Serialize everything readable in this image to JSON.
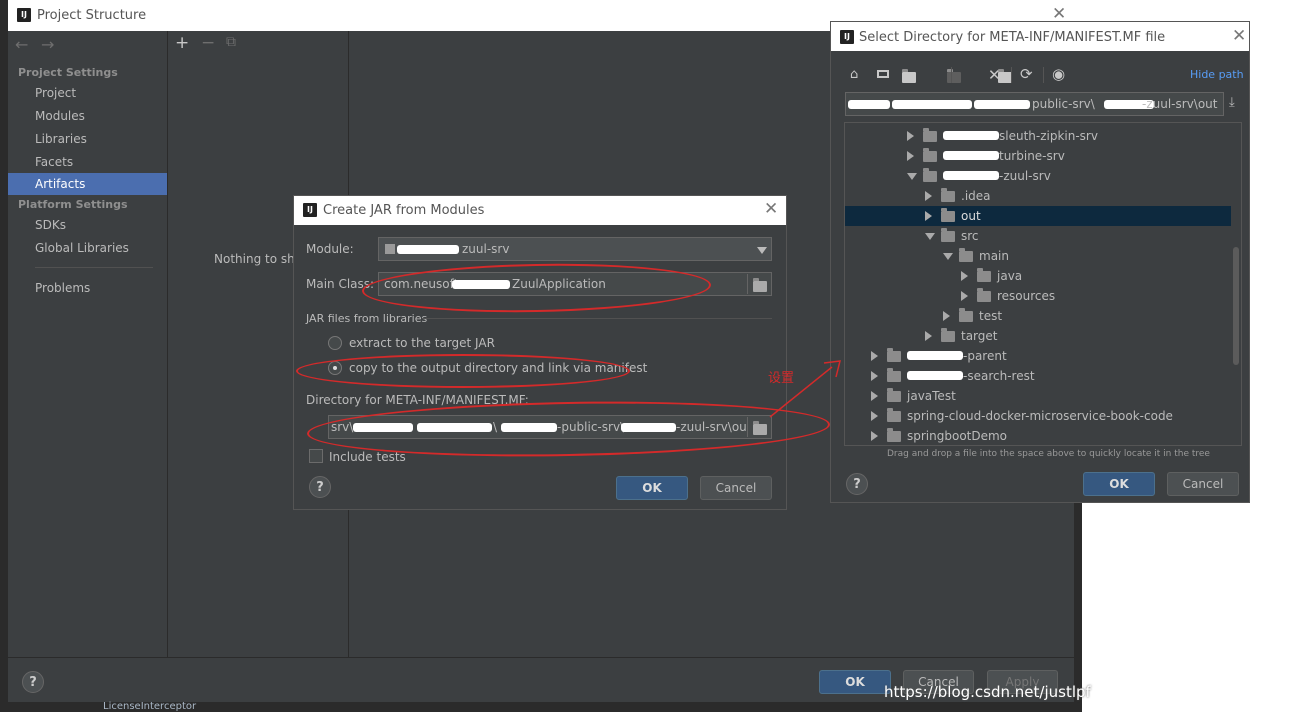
{
  "project_structure": {
    "title": "Project Structure",
    "icon_text": "IJ",
    "nav_back": "←",
    "nav_forward": "→",
    "toolbar_add": "+",
    "toolbar_remove": "−",
    "toolbar_copy": "⧉",
    "sections": [
      {
        "header": "Project Settings",
        "items": [
          "Project",
          "Modules",
          "Libraries",
          "Facets",
          "Artifacts"
        ]
      },
      {
        "header": "Platform Settings",
        "items": [
          "SDKs",
          "Global Libraries"
        ]
      }
    ],
    "problems": "Problems",
    "selected_item": "Artifacts",
    "empty_text": "Nothing to sho",
    "ok_label": "OK",
    "cancel_label": "Cancel",
    "apply_label": "Apply",
    "help_label": "?",
    "background_text": "LicenseInterceptor"
  },
  "create_jar": {
    "title": "Create JAR from Modules",
    "module_label": "Module:",
    "module_value": "zuul-srv",
    "main_class_label": "Main Class:",
    "main_class_prefix": "com.neusoft.",
    "main_class_suffix": "ZuulApplication",
    "jar_files_label": "JAR files from libraries",
    "radio_extract": "extract to the target JAR",
    "radio_copy": "copy to the output directory and link via manifest",
    "selected_radio": "copy",
    "directory_label": "Directory for META-INF/MANIFEST.MF:",
    "directory_prefix": "srv\\",
    "directory_mid1": "\\",
    "directory_mid2": "-public-srv\\",
    "directory_suffix": "-zuul-srv\\out",
    "include_tests": "Include tests",
    "ok_label": "OK",
    "cancel_label": "Cancel",
    "help_label": "?"
  },
  "select_dir": {
    "title": "Select Directory for META-INF/MANIFEST.MF file",
    "hide_path": "Hide path",
    "path_mid": "public-srv\\",
    "path_suffix": "-zuul-srv\\out",
    "tree": [
      {
        "label": "sleuth-zipkin-srv",
        "level": 4,
        "expanded": false,
        "redacted": true
      },
      {
        "label": "turbine-srv",
        "level": 4,
        "expanded": false,
        "redacted": true
      },
      {
        "label": "-zuul-srv",
        "level": 4,
        "expanded": true,
        "redacted": true
      },
      {
        "label": ".idea",
        "level": 5,
        "expanded": false,
        "redacted": false
      },
      {
        "label": "out",
        "level": 5,
        "expanded": false,
        "redacted": false,
        "selected": true
      },
      {
        "label": "src",
        "level": 5,
        "expanded": true,
        "redacted": false
      },
      {
        "label": "main",
        "level": 6,
        "expanded": true,
        "redacted": false
      },
      {
        "label": "java",
        "level": 7,
        "expanded": false,
        "redacted": false
      },
      {
        "label": "resources",
        "level": 7,
        "expanded": false,
        "redacted": false
      },
      {
        "label": "test",
        "level": 6,
        "expanded": false,
        "redacted": false
      },
      {
        "label": "target",
        "level": 5,
        "expanded": false,
        "redacted": false
      },
      {
        "label": "-parent",
        "level": 3,
        "expanded": false,
        "redacted": true
      },
      {
        "label": "-search-rest",
        "level": 3,
        "expanded": false,
        "redacted": true
      },
      {
        "label": "javaTest",
        "level": 3,
        "expanded": false,
        "redacted": false
      },
      {
        "label": "spring-cloud-docker-microservice-book-code",
        "level": 3,
        "expanded": false,
        "redacted": false
      },
      {
        "label": "springbootDemo",
        "level": 3,
        "expanded": false,
        "redacted": false
      }
    ],
    "hint": "Drag and drop a file into the space above to quickly locate it in the tree",
    "ok_label": "OK",
    "cancel_label": "Cancel",
    "help_label": "?"
  },
  "annotation": {
    "note": "设置",
    "watermark": "https://blog.csdn.net/justlpf"
  },
  "colors": {
    "dialog_bg": "#3c3f41",
    "selection": "#4b6eaf",
    "tree_selection": "#0d293e",
    "primary_button": "#365880",
    "annotation_red": "#d42a2a"
  }
}
